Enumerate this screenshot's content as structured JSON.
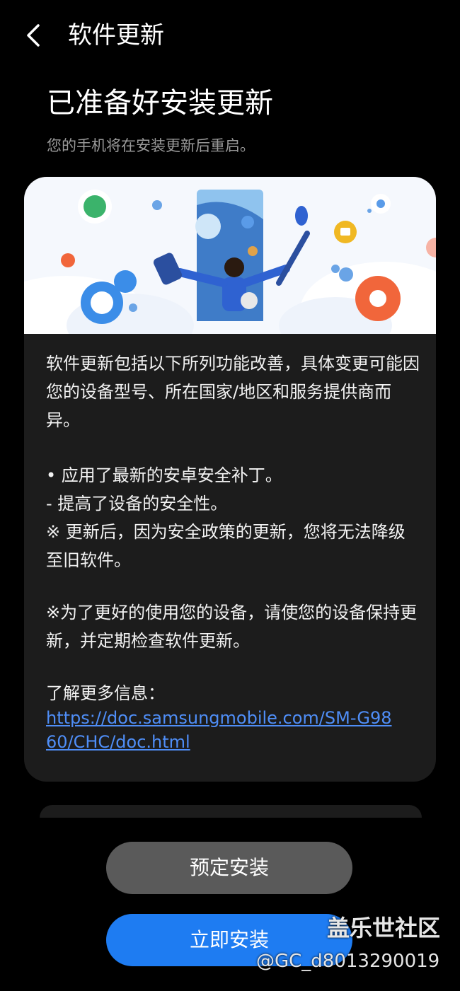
{
  "topbar": {
    "back_icon": "chevron-left-icon",
    "title": "软件更新"
  },
  "header": {
    "title": "已准备好安装更新",
    "subtitle": "您的手机将在安装更新后重启。"
  },
  "card": {
    "description": "软件更新包括以下所列功能改善，具体变更可能因您的设备型号、所在国家/地区和服务提供商而异。",
    "items": [
      "• 应用了最新的安卓安全补丁。",
      " - 提高了设备的安全性。",
      "※ 更新后，因为安全政策的更新，您将无法降级至旧软件。",
      "※为了更好的使用您的设备，请使您的设备保持更新，并定期检查软件更新。"
    ],
    "more_info_label": "了解更多信息：",
    "link": "https://doc.samsungmobile.com/SM-G9860/CHC/doc.html"
  },
  "buttons": {
    "schedule": "预定安装",
    "install_now": "立即安装"
  },
  "watermark": {
    "title": "盖乐世社区",
    "handle": "@GC_d8013290019"
  },
  "colors": {
    "background": "#000000",
    "card": "#1c1c1c",
    "link": "#4f8ef7",
    "primary_button": "#1e7cf2",
    "secondary_button": "#5a5a5a"
  }
}
